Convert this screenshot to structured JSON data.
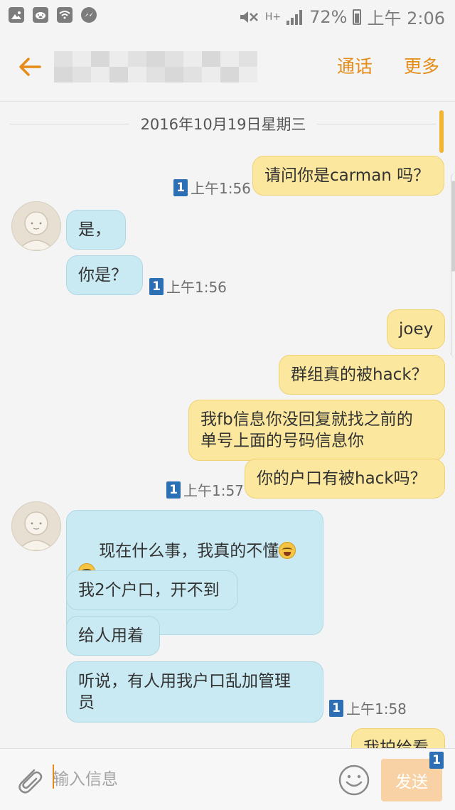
{
  "status_bar": {
    "network": "H+",
    "battery_percent": "72%",
    "time": "上午 2:06",
    "icons": [
      "gallery-icon",
      "pig-icon",
      "wifi-icon",
      "messenger-icon",
      "mute-icon",
      "signal-icon",
      "battery-icon"
    ]
  },
  "header": {
    "contact_name_hidden": true,
    "call_label": "通话",
    "more_label": "更多",
    "accent_color": "#e48b18"
  },
  "chat": {
    "date_separator": "2016年10月19日星期三",
    "messages": [
      {
        "dir": "out",
        "text": "请问你是carman 吗？"
      },
      {
        "dir": "in",
        "text": "是，"
      },
      {
        "dir": "in",
        "text": "你是？"
      },
      {
        "dir": "out",
        "text": "joey"
      },
      {
        "dir": "out",
        "text": "群组真的被hack？"
      },
      {
        "dir": "out",
        "text": "我fb信息你没回复就找之前的\n单号上面的号码信息你"
      },
      {
        "dir": "out",
        "text": "你的户口有被hack吗？"
      },
      {
        "dir": "in",
        "line1": "现在什么事，我真的不懂",
        "emoji": "laughing-tears-emoji"
      },
      {
        "dir": "in",
        "text": "我2个户口，开不到"
      },
      {
        "dir": "in",
        "text": "给人用着"
      },
      {
        "dir": "in",
        "text": "听说，有人用我户口乱加管理\n员"
      },
      {
        "dir": "out",
        "text": "我拍给看"
      }
    ],
    "meta": [
      {
        "badge": "1",
        "time": "上午1:56"
      },
      {
        "badge": "1",
        "time": "上午1:56"
      },
      {
        "badge": "1",
        "time": "上午1:57"
      },
      {
        "badge": "1",
        "time": "上午1:58"
      }
    ]
  },
  "input_bar": {
    "placeholder": "输入信息",
    "send_label": "发送",
    "send_badge": "1"
  }
}
